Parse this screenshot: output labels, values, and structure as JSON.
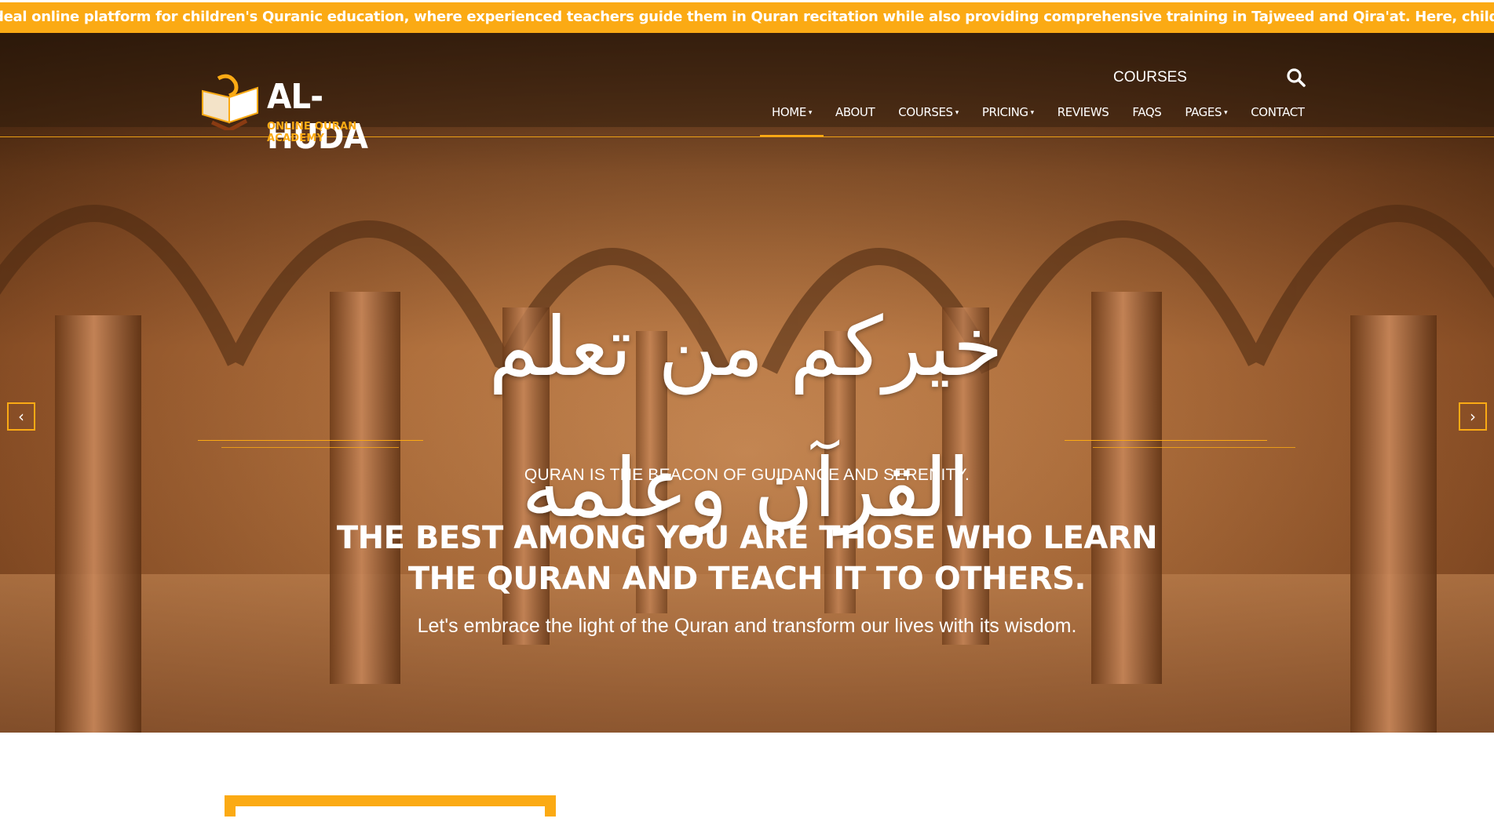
{
  "ticker": {
    "text": "deal online platform for children's Quranic education, where experienced teachers guide them in Quran recitation while also providing comprehensive training in Tajweed and Qira'at. Here, children are"
  },
  "header": {
    "logo": {
      "name": "AL-HUDA",
      "subtitle": "ONLINE QURAN ACADEMY",
      "icon": "open-quran-book-icon"
    },
    "top_link": "COURSES",
    "search_icon": "search-icon",
    "nav": [
      {
        "label": "HOME",
        "dropdown": true,
        "active": true
      },
      {
        "label": "ABOUT",
        "dropdown": false
      },
      {
        "label": "COURSES",
        "dropdown": true
      },
      {
        "label": "PRICING",
        "dropdown": true
      },
      {
        "label": "REVIEWS",
        "dropdown": false
      },
      {
        "label": "FAQS",
        "dropdown": false
      },
      {
        "label": "PAGES",
        "dropdown": true
      },
      {
        "label": "CONTACT",
        "dropdown": false
      }
    ],
    "caret": "▾"
  },
  "hero": {
    "calligraphy": "خيركم من تعلم القرآن وعلمه",
    "tagline": "QURAN IS THE BEACON OF GUIDANCE AND SERENITY.",
    "headline_line1": "THE BEST AMONG YOU ARE THOSE WHO LEARN",
    "headline_line2": "THE QURAN AND TEACH IT TO OTHERS.",
    "subline": "Let's embrace the light of the Quran and transform our lives with its wisdom.",
    "prev_arrow": "‹",
    "next_arrow": "›"
  },
  "colors": {
    "accent": "#fbaa14",
    "text_on_dark": "#ffffff"
  }
}
